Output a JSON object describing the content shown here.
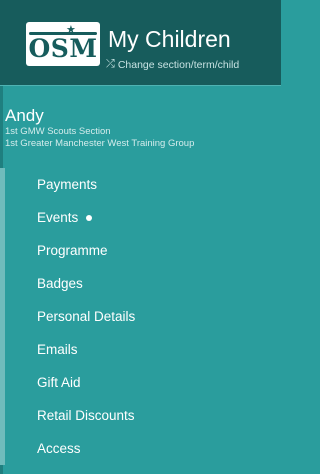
{
  "header": {
    "logo_text": "OSM",
    "title": "My Children",
    "change_link": "Change section/term/child",
    "change_icon": "shuffle-icon"
  },
  "member": {
    "name": "Andy",
    "section": "1st GMW Scouts Section",
    "group": "1st Greater Manchester West Training Group"
  },
  "nav": {
    "items": [
      {
        "label": "Payments"
      },
      {
        "label": "Events",
        "indicator": "dot"
      },
      {
        "label": "Programme"
      },
      {
        "label": "Badges"
      },
      {
        "label": "Personal Details"
      },
      {
        "label": "Emails"
      },
      {
        "label": "Gift Aid"
      },
      {
        "label": "Retail Discounts"
      },
      {
        "label": "Access"
      }
    ]
  },
  "colors": {
    "header_bg": "#175c5c",
    "body_bg": "#2a9d9d",
    "nav_border": "#6fbcbc"
  }
}
